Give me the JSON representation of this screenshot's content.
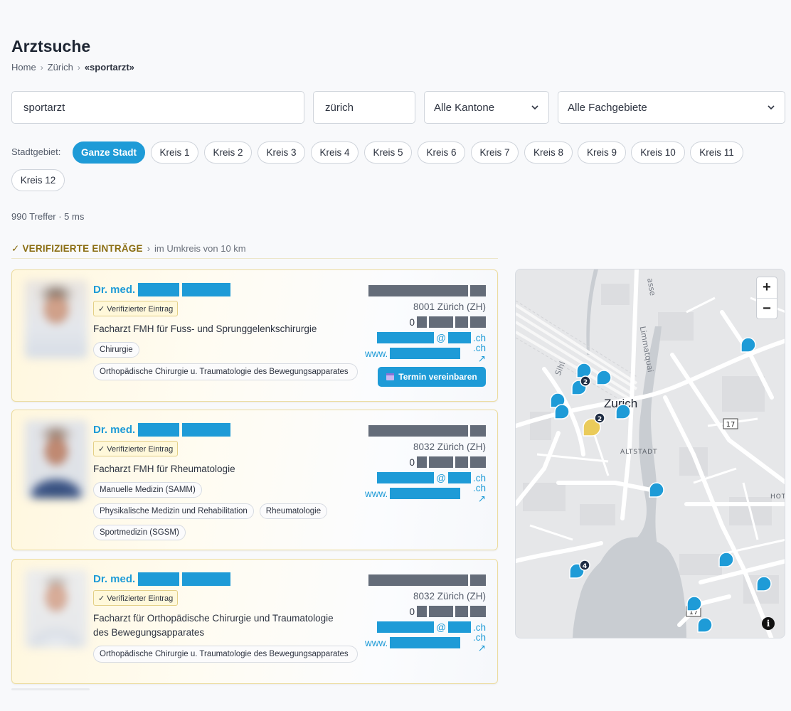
{
  "header": {
    "title": "Arztsuche",
    "breadcrumb": [
      "Home",
      "Zürich",
      "«sportarzt»"
    ]
  },
  "search": {
    "query": "sportarzt",
    "location": "zürich",
    "canton_selected": "Alle Kantone",
    "specialty_selected": "Alle Fachgebiete"
  },
  "districts": {
    "label": "Stadtgebiet:",
    "items": [
      "Ganze Stadt",
      "Kreis 1",
      "Kreis 2",
      "Kreis 3",
      "Kreis 4",
      "Kreis 5",
      "Kreis 6",
      "Kreis 7",
      "Kreis 8",
      "Kreis 9",
      "Kreis 10",
      "Kreis 11",
      "Kreis 12"
    ],
    "active": "Ganze Stadt"
  },
  "results": {
    "meta": "990 Treffer · 5 ms",
    "section_title": "✓ VERIFIZIERTE EINTRÄGE",
    "section_sep": "›",
    "section_sub": "im Umkreis von 10 km"
  },
  "cards": [
    {
      "name_prefix": "Dr. med.",
      "badge": "✓ Verifizierter Eintrag",
      "specialty": "Facharzt FMH für Fuss- und Sprunggelenkschirurgie",
      "tags": [
        "Chirurgie",
        "Orthopädische Chirurgie u. Traumatologie des Bewegungsapparates"
      ],
      "city": "8001 Zürich (ZH)",
      "phone_prefix": "0",
      "email_at": "@",
      "email_tld": ".ch",
      "web_prefix": "www.",
      "web_suffix": ".ch ↗",
      "button": "Termin vereinbaren"
    },
    {
      "name_prefix": "Dr. med.",
      "badge": "✓ Verifizierter Eintrag",
      "specialty": "Facharzt FMH für Rheumatologie",
      "tags": [
        "Manuelle Medizin (SAMM)",
        "Physikalische Medizin und Rehabilitation",
        "Rheumatologie",
        "Sportmedizin (SGSM)"
      ],
      "city": "8032 Zürich (ZH)",
      "phone_prefix": "0",
      "email_at": "@",
      "email_tld": ".ch",
      "web_prefix": "www.",
      "web_suffix": ".ch ↗"
    },
    {
      "name_prefix": "Dr. med.",
      "badge": "✓ Verifizierter Eintrag",
      "specialty": "Facharzt für Orthopädische Chirurgie und Traumatologie des Bewegungsapparates",
      "tags": [
        "Orthopädische Chirurgie u. Traumatologie des Bewegungsapparates"
      ],
      "city": "8032 Zürich (ZH)",
      "phone_prefix": "0",
      "email_at": "@",
      "email_tld": ".ch",
      "web_prefix": "www.",
      "web_suffix": ".ch ↗"
    }
  ],
  "map": {
    "labels": {
      "city": "Zurich",
      "altstadt": "ALTSTADT",
      "route_17": "17",
      "hotel_fragment": "HOT",
      "street_fragment": "asse",
      "street_limmatquai": "Limmatquai",
      "street_sihl": "Sihl"
    },
    "zoom_in": "+",
    "zoom_out": "−",
    "info": "i",
    "cluster_labels": [
      "2",
      "2",
      "4"
    ],
    "colors": {
      "marker": "#1e9bd7",
      "marker_selected": "#eacb5a",
      "cluster": "#1f2d44",
      "water": "#c9cdd2",
      "roads": "#ffffff"
    }
  },
  "colors": {
    "accent": "#1e9bd7",
    "verified": "#8a6d12"
  }
}
